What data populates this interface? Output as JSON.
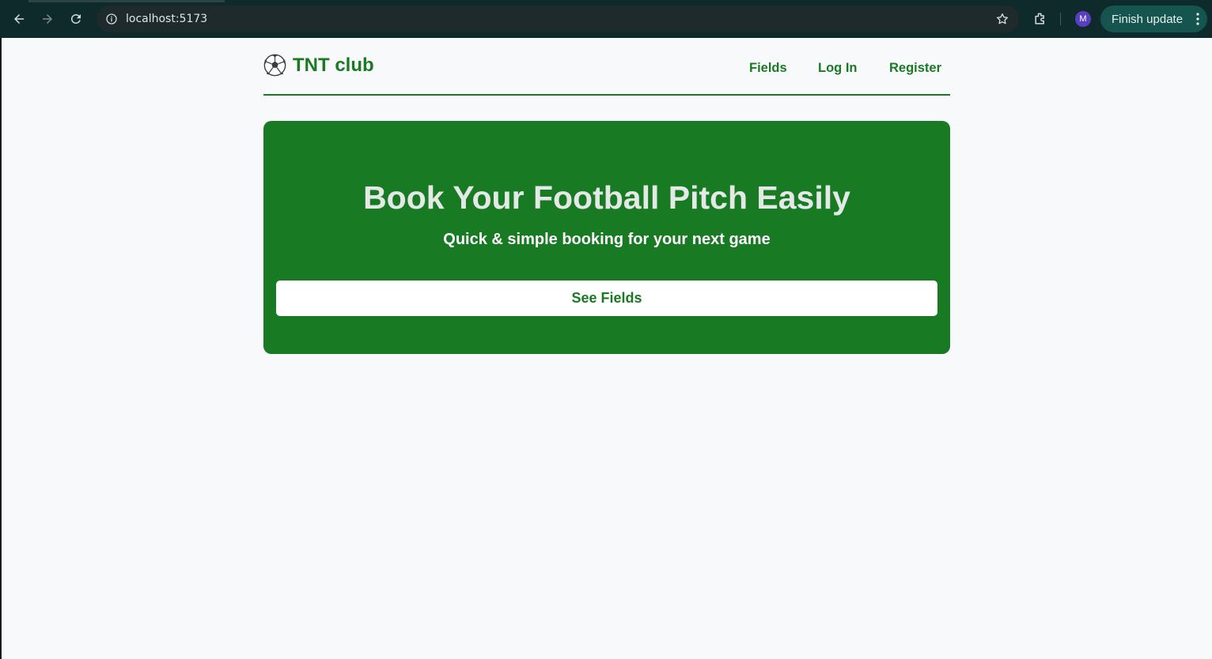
{
  "browser": {
    "url": "localhost:5173",
    "profile_initial": "M",
    "update_label": "Finish update",
    "icons": [
      "back-icon",
      "forward-icon",
      "reload-icon",
      "info-icon",
      "star-icon",
      "extensions-icon",
      "more-icon"
    ]
  },
  "site": {
    "brand": "TNT club",
    "brand_icon": "soccer-ball-icon",
    "nav": {
      "fields": "Fields",
      "login": "Log In",
      "register": "Register"
    }
  },
  "hero": {
    "title": "Book Your Football Pitch Easily",
    "subtitle": "Quick & simple booking for your next game",
    "cta": "See Fields"
  },
  "colors": {
    "brand_green": "#1a7a24",
    "hero_green": "#187a22",
    "page_bg": "#f8f9fb",
    "chrome_bg": "#0f2a2a"
  }
}
